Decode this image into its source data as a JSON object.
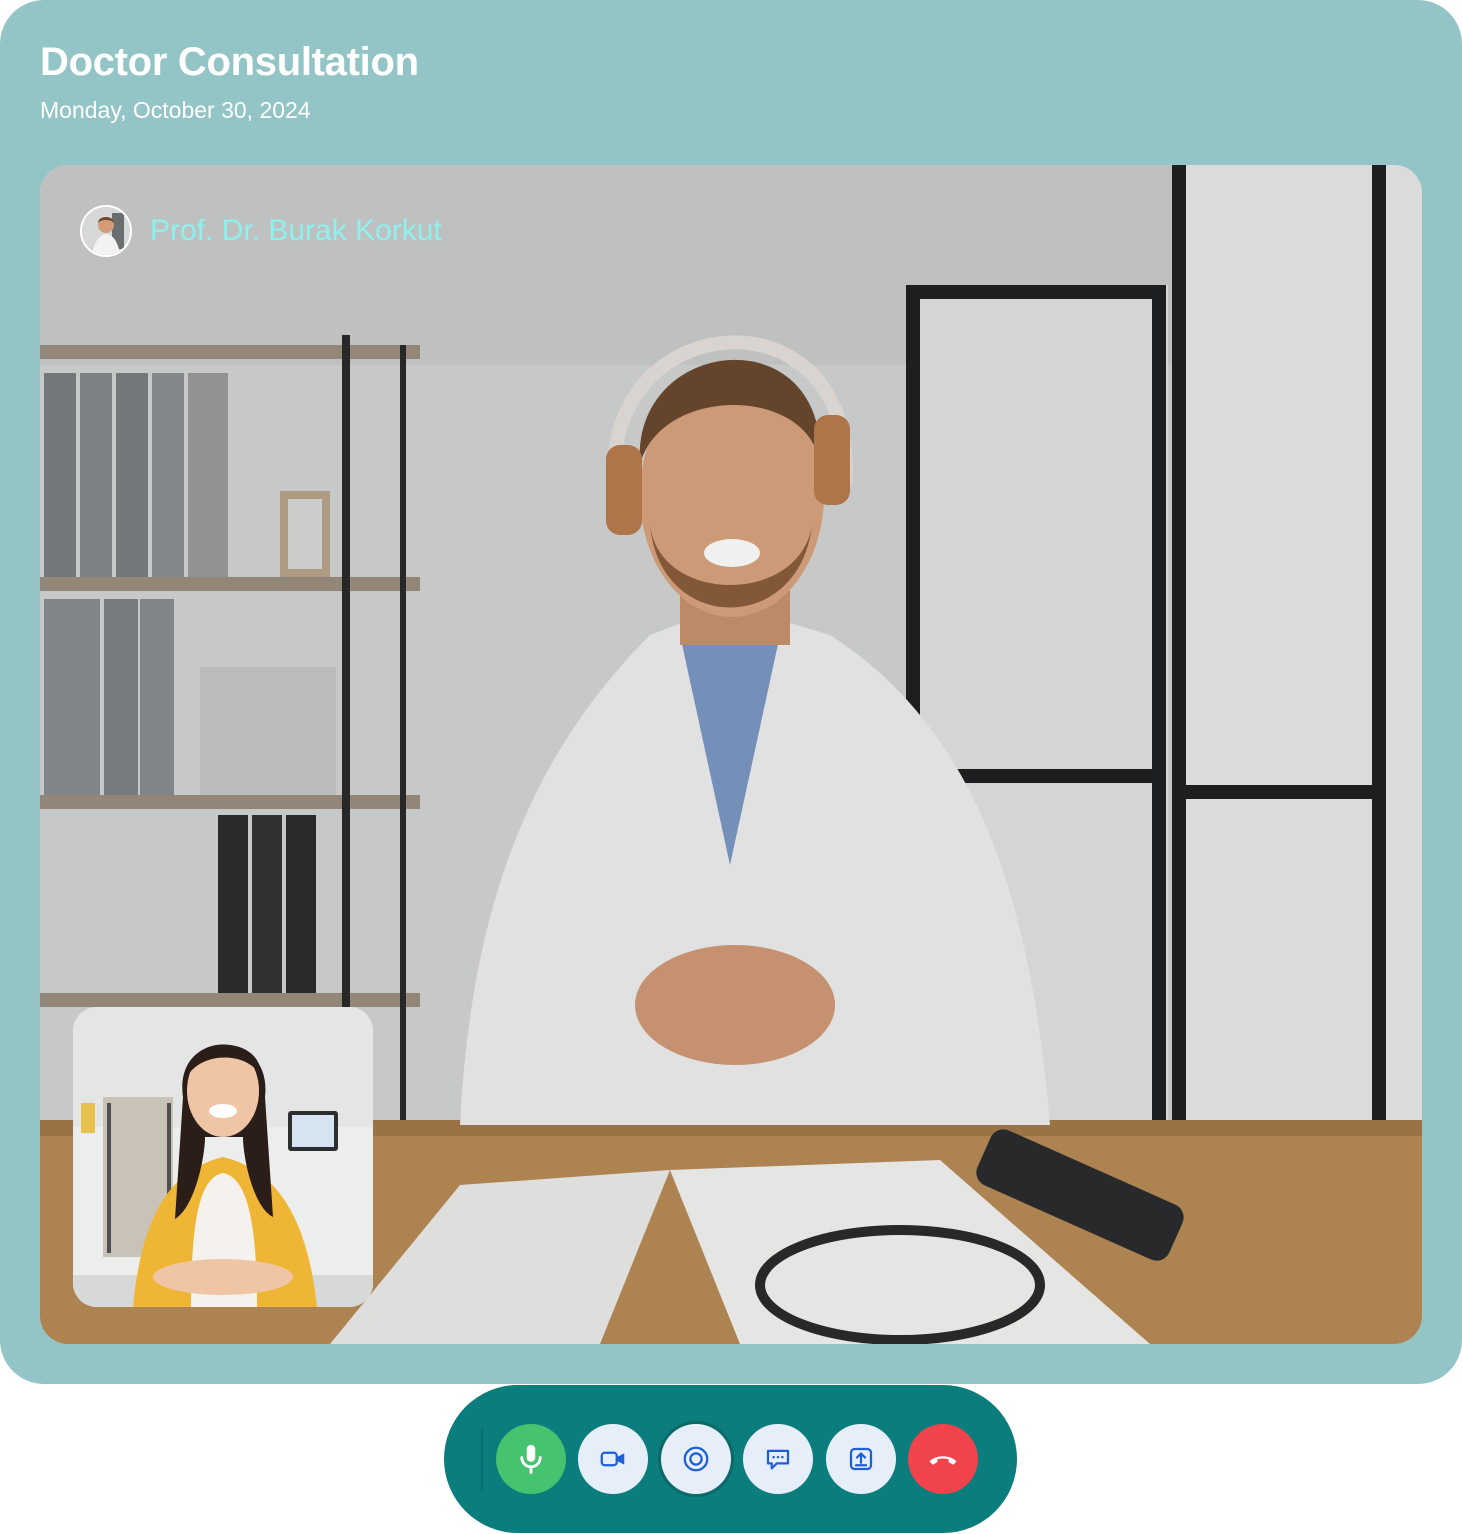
{
  "header": {
    "title": "Doctor Consultation",
    "date": "Monday, October 30, 2024"
  },
  "call": {
    "remote_name": "Prof. Dr. Burak Korkut"
  },
  "controls": [
    {
      "id": "microphone",
      "icon": "microphone-icon",
      "active": true,
      "color": "#46c36f"
    },
    {
      "id": "camera",
      "icon": "video-camera-icon"
    },
    {
      "id": "record",
      "icon": "record-icon"
    },
    {
      "id": "chat",
      "icon": "chat-bubble-icon"
    },
    {
      "id": "share-screen",
      "icon": "share-screen-icon"
    },
    {
      "id": "end-call",
      "icon": "phone-hangup-icon",
      "color": "#f0434b"
    }
  ],
  "colors": {
    "card_background": "#93c5c6",
    "controls_bar": "#0b7d7c",
    "caller_name": "#8ef1ee",
    "button_light": "#e6eef9"
  }
}
